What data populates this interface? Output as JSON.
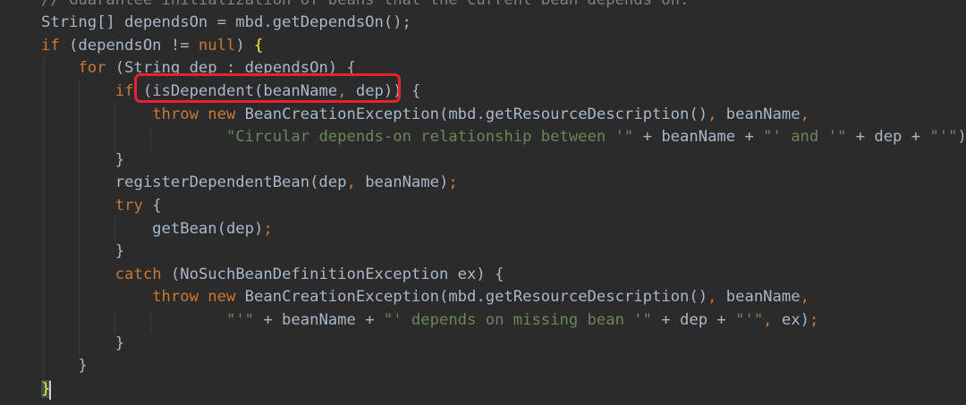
{
  "editor": {
    "language": "java",
    "colors": {
      "background": "#2b2b2b",
      "keyword": "#cc7832",
      "string": "#6a8759",
      "comment": "#808080",
      "text": "#a9b7c6",
      "brace_match": "#ffef28",
      "highlight_box": "#e8232d"
    },
    "lines": [
      [
        {
          "t": "// Guarantee initialization of beans that the current bean depends on.",
          "c": "comment"
        }
      ],
      [
        {
          "t": "String[] dependsOn = mbd.getDependsOn();",
          "c": "plain"
        }
      ],
      [
        {
          "t": "if",
          "c": "kw"
        },
        {
          "t": " (dependsOn != ",
          "c": "plain"
        },
        {
          "t": "null",
          "c": "kw"
        },
        {
          "t": ") ",
          "c": "plain"
        },
        {
          "t": "{",
          "c": "brace-match"
        }
      ],
      [
        {
          "t": "    ",
          "c": "plain"
        },
        {
          "t": "for",
          "c": "kw"
        },
        {
          "t": " (String dep : dependsOn) {",
          "c": "plain"
        }
      ],
      [
        {
          "t": "        ",
          "c": "plain"
        },
        {
          "t": "if",
          "c": "kw"
        },
        {
          "t": " (isDependent(beanName",
          "c": "plain"
        },
        {
          "t": ",",
          "c": "kw"
        },
        {
          "t": " dep)) {",
          "c": "plain"
        }
      ],
      [
        {
          "t": "            ",
          "c": "plain"
        },
        {
          "t": "throw new",
          "c": "kw"
        },
        {
          "t": " BeanCreationException(mbd.getResourceDescription()",
          "c": "plain"
        },
        {
          "t": ",",
          "c": "kw"
        },
        {
          "t": " beanName",
          "c": "plain"
        },
        {
          "t": ",",
          "c": "kw"
        }
      ],
      [
        {
          "t": "                    ",
          "c": "plain"
        },
        {
          "t": "\"Circular depends-on relationship between '\"",
          "c": "str"
        },
        {
          "t": " + beanName + ",
          "c": "plain"
        },
        {
          "t": "\"' and '\"",
          "c": "str"
        },
        {
          "t": " + dep + ",
          "c": "plain"
        },
        {
          "t": "\"'\"",
          "c": "str"
        },
        {
          "t": ")",
          "c": "plain"
        },
        {
          "t": ";",
          "c": "kw"
        }
      ],
      [
        {
          "t": "        }",
          "c": "plain"
        }
      ],
      [
        {
          "t": "        registerDependentBean(dep",
          "c": "plain"
        },
        {
          "t": ",",
          "c": "kw"
        },
        {
          "t": " beanName)",
          "c": "plain"
        },
        {
          "t": ";",
          "c": "kw"
        }
      ],
      [
        {
          "t": "        ",
          "c": "plain"
        },
        {
          "t": "try",
          "c": "kw"
        },
        {
          "t": " {",
          "c": "plain"
        }
      ],
      [
        {
          "t": "            getBean(dep)",
          "c": "plain"
        },
        {
          "t": ";",
          "c": "kw"
        }
      ],
      [
        {
          "t": "        }",
          "c": "plain"
        }
      ],
      [
        {
          "t": "        ",
          "c": "plain"
        },
        {
          "t": "catch",
          "c": "kw"
        },
        {
          "t": " (NoSuchBeanDefinitionException ex) {",
          "c": "plain"
        }
      ],
      [
        {
          "t": "            ",
          "c": "plain"
        },
        {
          "t": "throw new",
          "c": "kw"
        },
        {
          "t": " BeanCreationException(mbd.getResourceDescription()",
          "c": "plain"
        },
        {
          "t": ",",
          "c": "kw"
        },
        {
          "t": " beanName",
          "c": "plain"
        },
        {
          "t": ",",
          "c": "kw"
        }
      ],
      [
        {
          "t": "                    ",
          "c": "plain"
        },
        {
          "t": "\"'\"",
          "c": "str"
        },
        {
          "t": " + beanName + ",
          "c": "plain"
        },
        {
          "t": "\"' depends on missing bean '\"",
          "c": "str"
        },
        {
          "t": " + dep + ",
          "c": "plain"
        },
        {
          "t": "\"'\"",
          "c": "str"
        },
        {
          "t": ",",
          "c": "kw"
        },
        {
          "t": " ex)",
          "c": "plain"
        },
        {
          "t": ";",
          "c": "kw"
        }
      ],
      [
        {
          "t": "        }",
          "c": "plain"
        }
      ],
      [
        {
          "t": "    }",
          "c": "plain"
        }
      ],
      [
        {
          "t": "}",
          "c": "caret-brace"
        }
      ]
    ]
  }
}
